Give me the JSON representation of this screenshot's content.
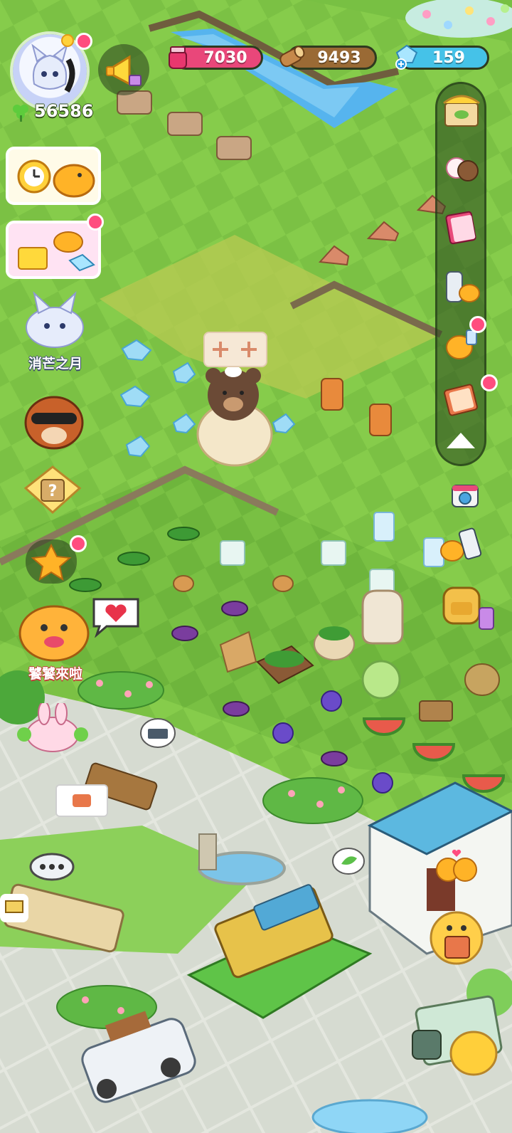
{
  "player": {
    "clover_count": "56586",
    "avatar_name": "消芒之月"
  },
  "resources": {
    "jam": "7030",
    "wood": "9493",
    "gems": "159"
  },
  "events": {
    "visitor_label": "饕饕來啦"
  },
  "colors": {
    "jam_bar": "#e9477a",
    "wood_bar": "#9a6a35",
    "gem_bar": "#45c2e8",
    "grass_light": "#8fd24f",
    "grass_dark": "#6db53c",
    "notify_dot": "#ff4d7f"
  },
  "icons": {
    "megaphone": "megaphone-icon",
    "jam_jar": "jam-jar-icon",
    "log": "wood-log-icon",
    "gem": "gem-icon",
    "clover": "clover-icon",
    "shop": "shop-stall-icon",
    "friends": "friends-icon",
    "album": "album-icon",
    "remote": "remote-icon",
    "quest": "quest-icon",
    "book": "recipe-book-icon",
    "collapse": "collapse-arrow-icon",
    "camera": "camera-icon",
    "phone": "phone-icon",
    "backpack": "backpack-icon",
    "chat": "chat-bubble-icon",
    "heart": "heart-icon",
    "mystery": "mystery-box-icon",
    "gift": "gift-icon",
    "map": "map-icon"
  }
}
